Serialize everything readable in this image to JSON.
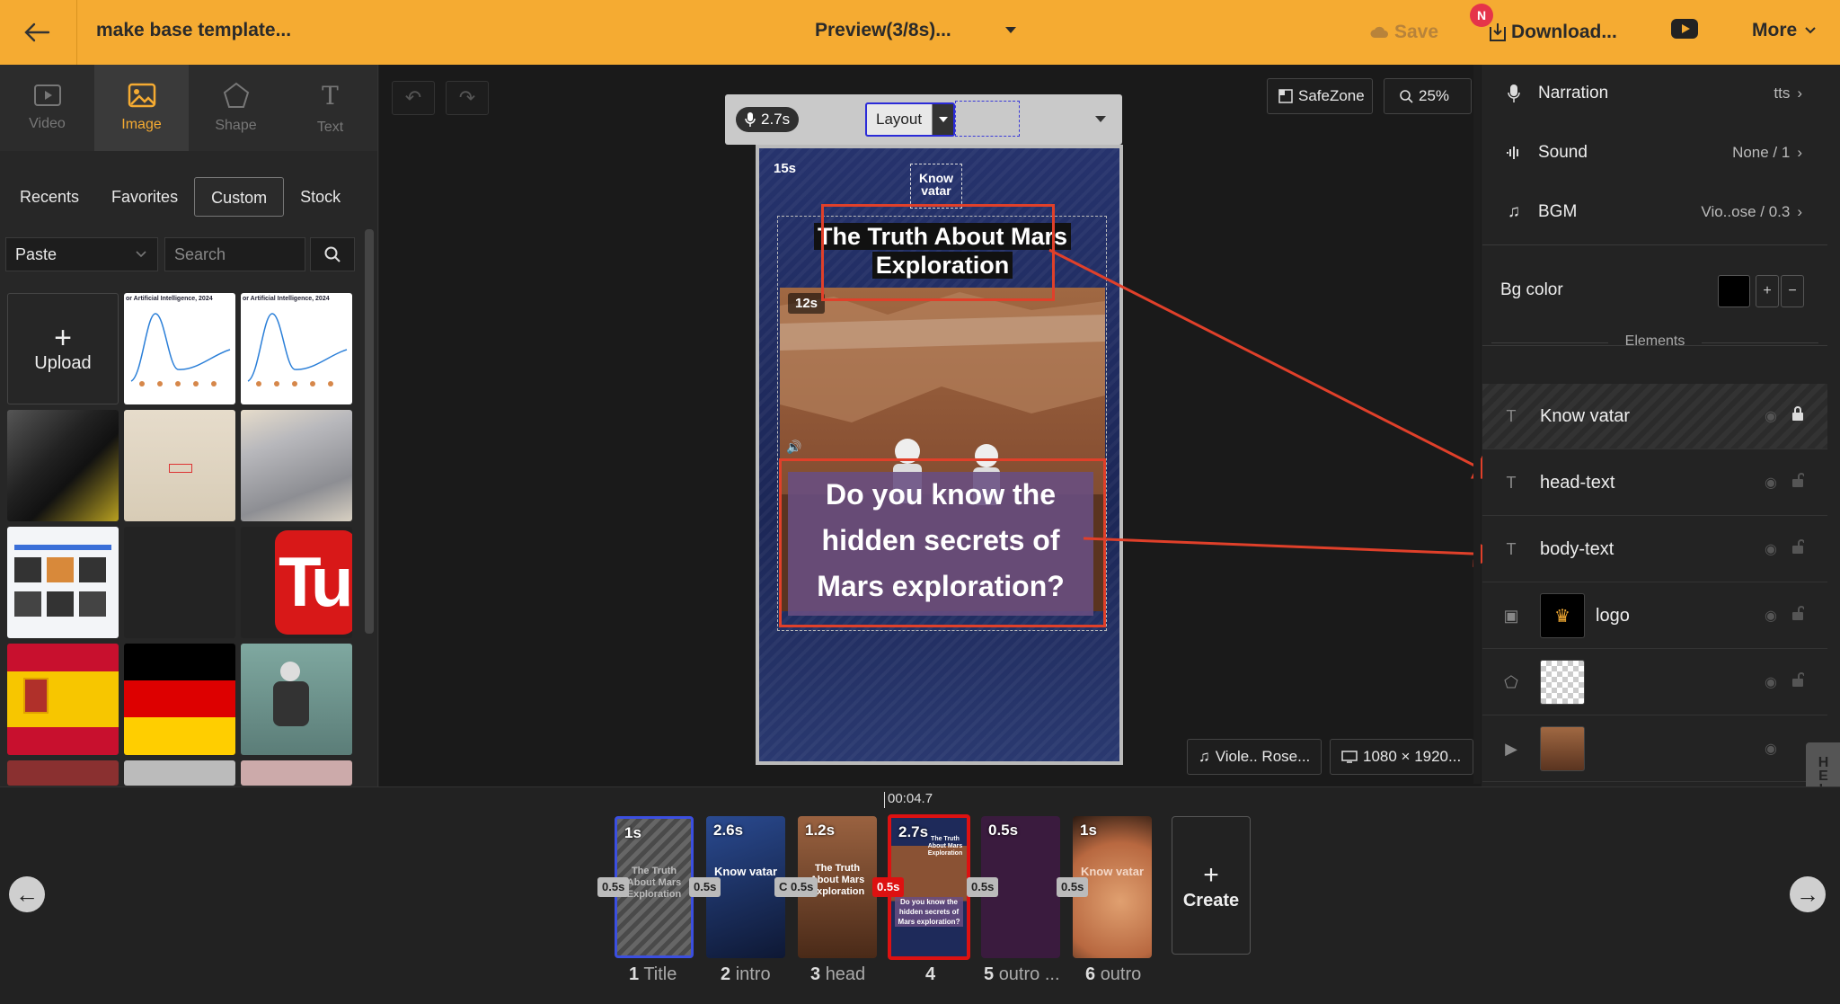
{
  "topbar": {
    "project_title": "make base template...",
    "preview_label": "Preview(3/8s)...",
    "save_label": "Save",
    "download_label": "Download...",
    "notification_badge": "N",
    "more_label": "More"
  },
  "tools": [
    {
      "label": "Video",
      "icon": "video-icon"
    },
    {
      "label": "Image",
      "icon": "image-icon",
      "active": true
    },
    {
      "label": "Shape",
      "icon": "pentagon-icon"
    },
    {
      "label": "Text",
      "icon": "text-icon"
    }
  ],
  "source_tabs": [
    {
      "label": "Recents"
    },
    {
      "label": "Favorites"
    },
    {
      "label": "Custom",
      "active": true
    },
    {
      "label": "Stock"
    }
  ],
  "paste_select": "Paste",
  "search_placeholder": "Search",
  "upload_label": "Upload",
  "media_thumbs": {
    "chart_caption_1": "or Artificial Intelligence, 2024",
    "chart_caption_2": "or Artificial Intelligence, 2024",
    "yt_text": "Tu"
  },
  "canvas": {
    "safezone_label": "SafeZone",
    "zoom_label": "25%",
    "scene_duration": "2.7s",
    "layout_label": "Layout",
    "music_label": "Viole.. Rose...",
    "dimensions_label": "1080 × 1920..."
  },
  "preview": {
    "badge_top": "15s",
    "logo_text_1": "Know",
    "logo_text_2": "vatar",
    "head_text": "The Truth About Mars Exploration",
    "badge_photo": "12s",
    "body_text": "Do you know the hidden secrets of Mars exploration?"
  },
  "right_panel": {
    "narration_label": "Narration",
    "narration_value": "tts",
    "sound_label": "Sound",
    "sound_value": "None / 1",
    "bgm_label": "BGM",
    "bgm_value": "Vio..ose / 0.3",
    "bg_color_label": "Bg color",
    "bg_color_value": "#000000",
    "elements_header": "Elements",
    "elements": [
      {
        "label": "Know vatar",
        "type": "text"
      },
      {
        "label": "head-text",
        "type": "text"
      },
      {
        "label": "body-text",
        "type": "text"
      },
      {
        "label": "logo",
        "type": "image"
      },
      {
        "label": "",
        "type": "shape"
      },
      {
        "label": "",
        "type": "video"
      }
    ]
  },
  "help_label": "HELP",
  "timeline": {
    "cursor_time": "00:04.7",
    "scenes": [
      {
        "duration": "1s",
        "number": "1",
        "name": "Title",
        "caption": "The Truth About Mars Exploration"
      },
      {
        "duration": "2.6s",
        "number": "2",
        "name": "intro",
        "caption": "Know vatar"
      },
      {
        "duration": "1.2s",
        "number": "3",
        "name": "head",
        "caption": "The Truth About Mars Exploration"
      },
      {
        "duration": "2.7s",
        "number": "4",
        "name": "",
        "caption": "Do you know the hidden secrets of Mars exploration?",
        "caption_top": "The Truth About Mars Exploration"
      },
      {
        "duration": "0.5s",
        "number": "5",
        "name": "outro ...",
        "caption": ""
      },
      {
        "duration": "1s",
        "number": "6",
        "name": "outro",
        "caption": "Know vatar"
      }
    ],
    "transitions": [
      "0.5s",
      "0.5s",
      "C 0.5s",
      "0.5s",
      "0.5s",
      "0.5s"
    ],
    "create_label": "Create"
  },
  "colors": {
    "topbar": "#f5ab32",
    "highlight_red": "#e0402a",
    "selected_scene": "#d11111"
  }
}
